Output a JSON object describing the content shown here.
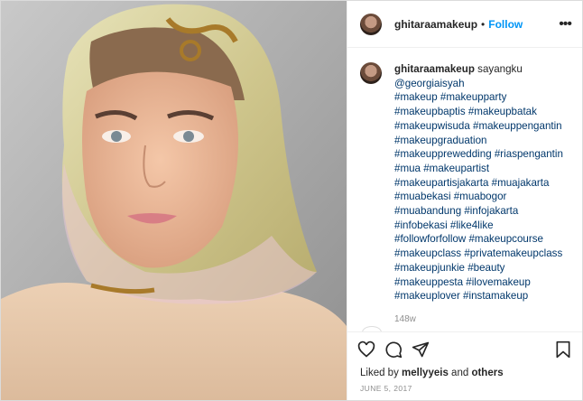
{
  "post": {
    "username": "ghitaraamakeup",
    "follow_label": "Follow",
    "separator": "•",
    "more_label": "•••",
    "caption": {
      "text": "sayangku",
      "mention": "@georgiaisyah",
      "hashtags": [
        "#makeup #makeupparty",
        "#makeupbaptis #makeupbatak",
        "#makeupwisuda #makeuppengantin",
        "#makeupgraduation",
        "#makeupprewedding #riaspengantin",
        "#mua #makeupartist",
        "#makeupartisjakarta #muajakarta",
        "#muabekasi #muabogor",
        "#muabandung #infojakarta",
        "#infobekasi #like4like",
        "#followforfollow #makeupcourse",
        "#makeupclass #privatemakeupclass",
        "#makeupjunkie #beauty",
        "#makeuppesta #ilovemakeup",
        "#makeuplover #instamakeup"
      ]
    },
    "age": "148w",
    "liked_prefix": "Liked by",
    "liked_user": "mellyyeis",
    "liked_suffix": "and",
    "liked_others": "others",
    "date": "JUNE 5, 2017"
  },
  "icons": {
    "like": "heart-icon",
    "comment": "comment-icon",
    "share": "share-icon",
    "save": "bookmark-icon",
    "more": "more-icon"
  },
  "colors": {
    "link": "#00376b",
    "follow": "#0095f6",
    "muted": "#8e8e8e"
  }
}
